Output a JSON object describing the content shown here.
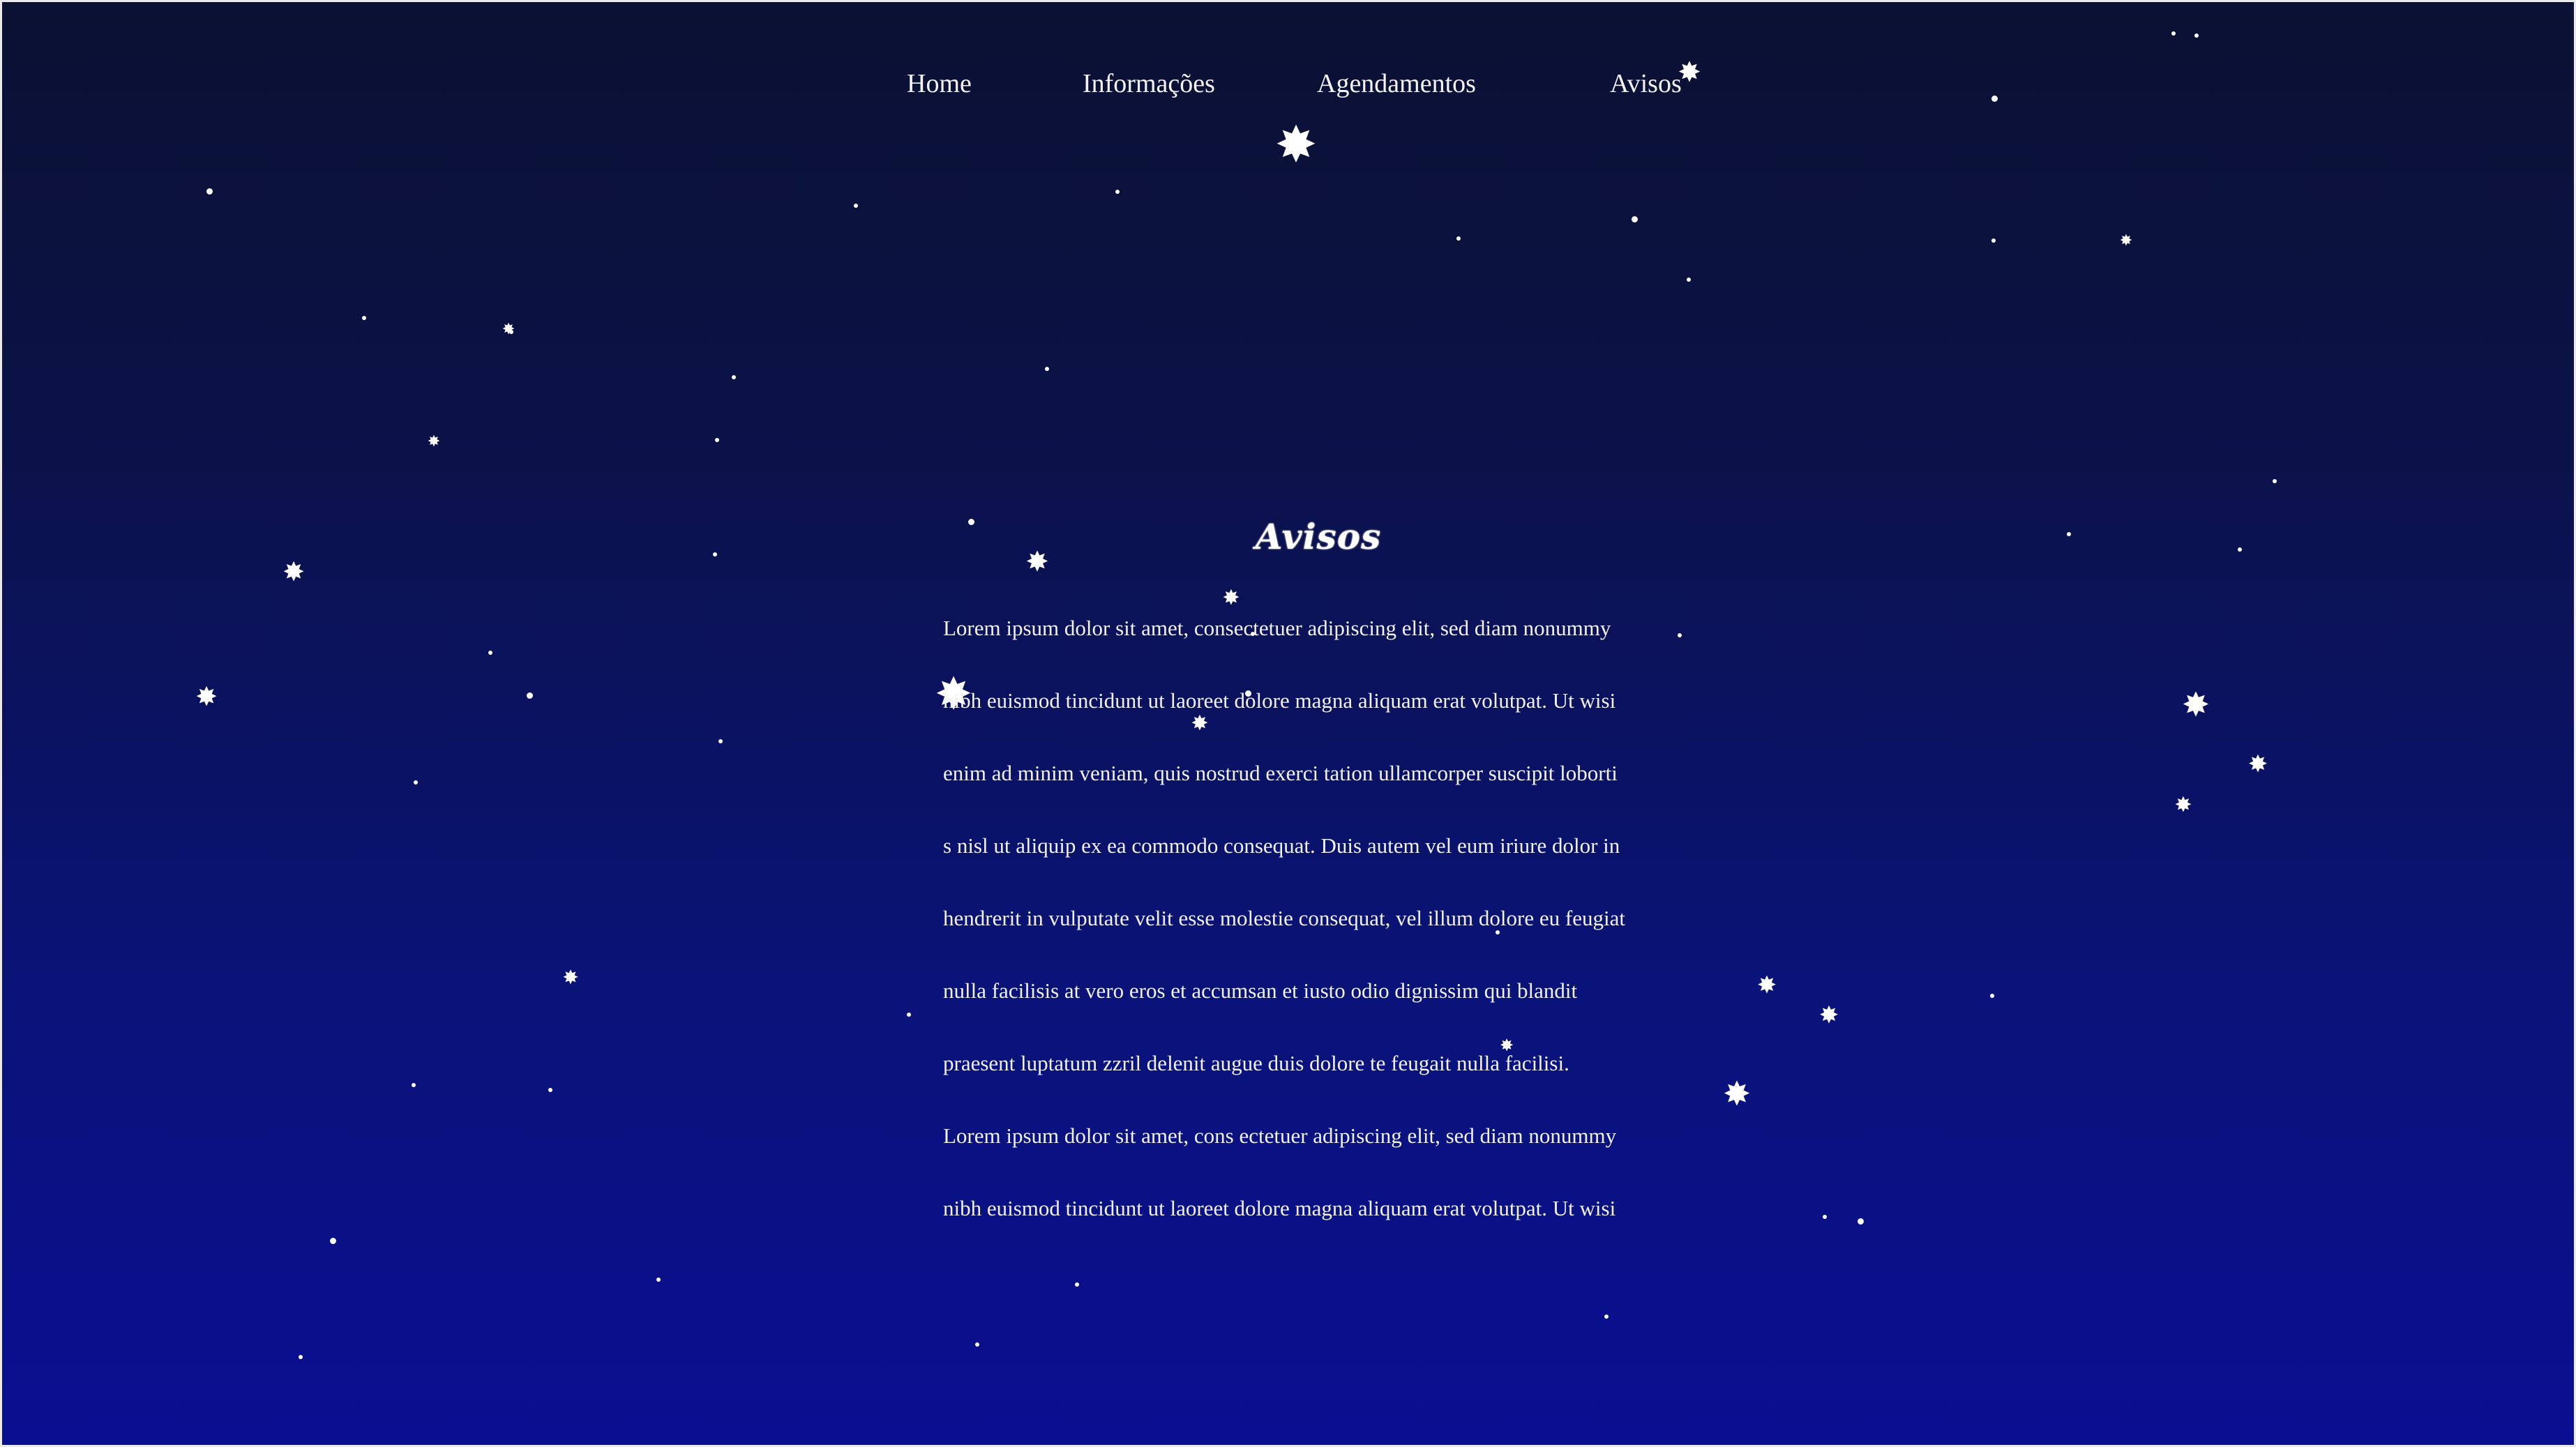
{
  "nav": {
    "items": [
      {
        "label": "Home"
      },
      {
        "label": "Informações"
      },
      {
        "label": "Agendamentos"
      },
      {
        "label": "Avisos"
      }
    ]
  },
  "main": {
    "title": "Avisos",
    "lines": [
      "Lorem ipsum dolor sit amet, consectetuer adipiscing elit, sed diam nonummy",
      "nibh euismod tincidunt ut laoreet dolore magna aliquam erat volutpat. Ut wisi",
      "enim ad minim veniam, quis nostrud exerci tation ullamcorper suscipit loborti",
      "s nisl ut aliquip ex ea commodo consequat. Duis autem vel eum iriure dolor in",
      "hendrerit in vulputate velit esse molestie consequat, vel illum dolore eu feugiat",
      "nulla facilisis at vero eros et accumsan et iusto odio dignissim qui blandit",
      "praesent luptatum zzril delenit augue duis dolore te feugait nulla facilisi.",
      "Lorem ipsum dolor sit amet, cons ectetuer adipiscing elit, sed diam nonummy",
      "nibh euismod tincidunt ut laoreet dolore magna aliquam erat volutpat. Ut wisi"
    ]
  },
  "theme": {
    "background_top": "#0b1132",
    "background_bottom": "#0a0f92",
    "text": "#ffffff"
  },
  "decor": {
    "icon": "star-icon"
  }
}
